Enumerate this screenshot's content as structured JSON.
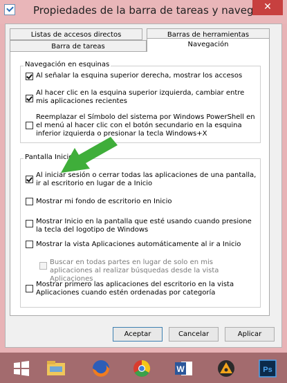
{
  "window": {
    "title": "Propiedades de la barra de tareas y navegación",
    "close_label": "✕"
  },
  "tabs": [
    {
      "label": "Listas de accesos directos"
    },
    {
      "label": "Barras de herramientas"
    },
    {
      "label": "Barra de tareas"
    },
    {
      "label": "Navegación"
    }
  ],
  "corners_group": {
    "title": "Navegación en esquinas",
    "options": [
      {
        "text": "Al señalar la esquina superior derecha, mostrar los accesos",
        "checked": true
      },
      {
        "text": "Al hacer clic en la esquina superior izquierda, cambiar entre mis aplicaciones recientes",
        "checked": true
      },
      {
        "text": "Reemplazar el Símbolo del sistema por Windows PowerShell en el menú al hacer clic con el botón secundario en la esquina inferior izquierda o presionar la tecla Windows+X",
        "checked": false
      }
    ]
  },
  "start_group": {
    "title": "Pantalla Inicio",
    "options": [
      {
        "text": "Al iniciar sesión o cerrar todas las aplicaciones de una pantalla, ir al escritorio en lugar de a Inicio",
        "checked": true
      },
      {
        "text": "Mostrar mi fondo de escritorio en Inicio",
        "checked": false
      },
      {
        "text": "Mostrar Inicio en la pantalla que esté usando cuando presione la tecla del logotipo de Windows",
        "checked": false
      },
      {
        "text": "Mostrar la vista Aplicaciones automáticamente al ir a Inicio",
        "checked": false
      },
      {
        "text": "Buscar en todas partes en lugar de solo en mis aplicaciones al realizar búsquedas desde la vista Aplicaciones",
        "checked": false,
        "disabled": true
      },
      {
        "text": "Mostrar primero las aplicaciones del escritorio en la vista Aplicaciones cuando estén ordenadas por categoría",
        "checked": false
      }
    ]
  },
  "buttons": {
    "accept": "Aceptar",
    "cancel": "Cancelar",
    "apply": "Aplicar"
  },
  "taskbar": {
    "items": [
      "windows-start-icon",
      "file-explorer-icon",
      "firefox-icon",
      "chrome-icon",
      "word-icon",
      "aimp-icon",
      "photoshop-icon"
    ],
    "word_letter": "W",
    "photoshop_letters": "Ps"
  },
  "colors": {
    "title_bar": "#e9b6b9",
    "close_button": "#c7403f",
    "taskbar": "#a36b6e",
    "annotation_arrow": "#3fae3a"
  }
}
